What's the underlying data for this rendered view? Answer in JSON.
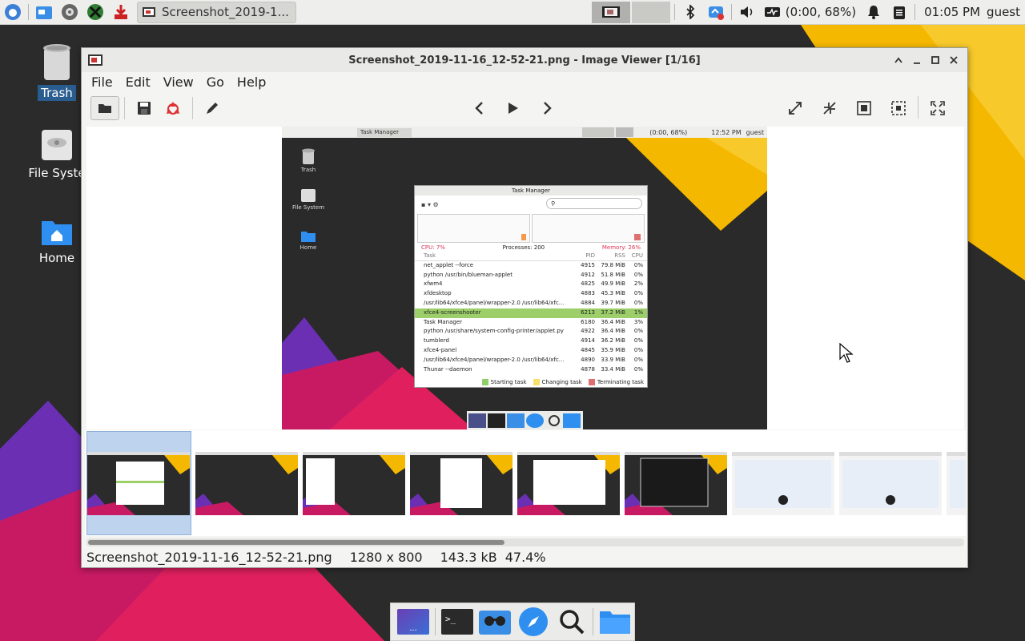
{
  "top_panel": {
    "launchers": [
      "whisker-menu-icon",
      "file-manager-icon",
      "settings-icon",
      "xfce-tool-icon",
      "downloads-icon"
    ],
    "task_button_label": "Screenshot_2019-1...",
    "battery_label": "(0:00, 68%)",
    "clock": "01:05 PM",
    "user": "guest"
  },
  "desktop": {
    "icons": [
      {
        "label": "Trash",
        "name": "trash"
      },
      {
        "label": "File Syste",
        "name": "file-system"
      },
      {
        "label": "Home",
        "name": "home"
      }
    ]
  },
  "window": {
    "title": "Screenshot_2019-11-16_12-52-21.png - Image Viewer [1/16]",
    "menus": [
      "File",
      "Edit",
      "View",
      "Go",
      "Help"
    ],
    "status": {
      "filename": "Screenshot_2019-11-16_12-52-21.png",
      "dimensions": "1280 x 800",
      "size": "143.3 kB",
      "zoom": "47.4%"
    }
  },
  "embedded_screenshot": {
    "task_label": "Task Manager",
    "battery": "(0:00, 68%)",
    "clock": "12:52 PM",
    "user": "guest",
    "desktop_icons": [
      "Trash",
      "File System",
      "Home"
    ],
    "task_manager": {
      "title": "Task Manager",
      "cpu": "CPU: 7%",
      "processes": "Processes: 200",
      "memory": "Memory: 26%",
      "headers": [
        "Task",
        "PID",
        "RSS",
        "CPU"
      ],
      "rows": [
        [
          "net_applet --force",
          "4915",
          "79.8 MiB",
          "0%"
        ],
        [
          "python /usr/bin/blueman-applet",
          "4912",
          "51.8 MiB",
          "0%"
        ],
        [
          "xfwm4",
          "4825",
          "49.9 MiB",
          "2%"
        ],
        [
          "xfdesktop",
          "4883",
          "45.3 MiB",
          "0%"
        ],
        [
          "/usr/lib64/xfce4/panel/wrapper-2.0 /usr/lib64/xfc...",
          "4884",
          "39.7 MiB",
          "0%"
        ],
        [
          "xfce4-screenshooter",
          "6213",
          "37.2 MiB",
          "1%"
        ],
        [
          "Task Manager",
          "6180",
          "36.4 MiB",
          "3%"
        ],
        [
          "python /usr/share/system-config-printer/applet.py",
          "4922",
          "36.4 MiB",
          "0%"
        ],
        [
          "tumblerd",
          "4914",
          "36.2 MiB",
          "0%"
        ],
        [
          "xfce4-panel",
          "4845",
          "35.9 MiB",
          "0%"
        ],
        [
          "/usr/lib64/xfce4/panel/wrapper-2.0 /usr/lib64/xfc...",
          "4890",
          "33.9 MiB",
          "0%"
        ],
        [
          "Thunar --daemon",
          "4878",
          "33.4 MiB",
          "0%"
        ]
      ],
      "legend": [
        "Starting task",
        "Changing task",
        "Terminating task"
      ],
      "legend_colors": [
        "#8fd06a",
        "#f5e06a",
        "#e07070"
      ]
    }
  }
}
